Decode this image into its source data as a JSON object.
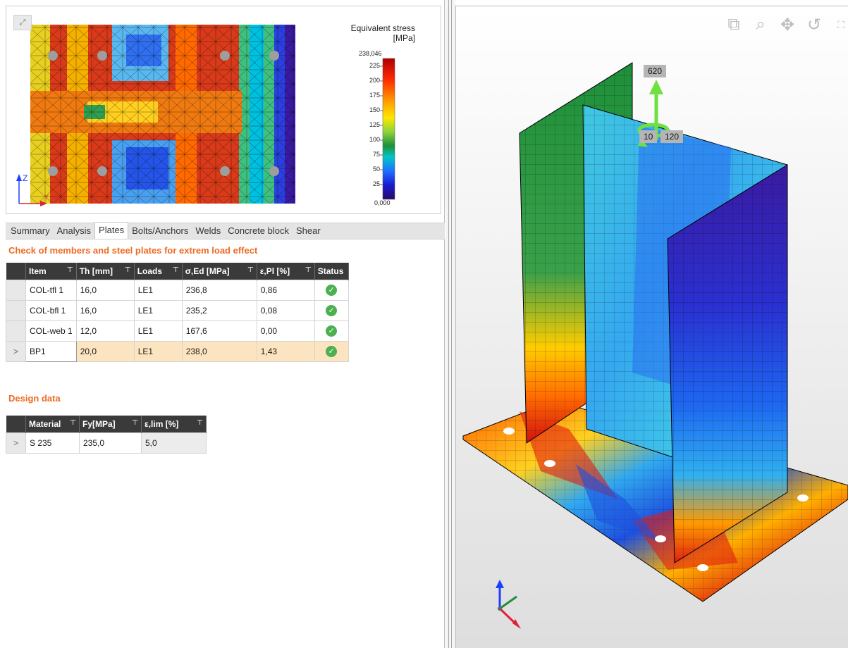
{
  "preview": {
    "legend_title": "Equivalent stress\n[MPa]",
    "legend_max": "238,046",
    "legend_min": "0,000",
    "legend_ticks": [
      "225",
      "200",
      "175",
      "150",
      "125",
      "100",
      "75",
      "50",
      "25"
    ],
    "axis_z": "Z",
    "axis_y": "Y"
  },
  "tabs": [
    {
      "label": "Summary"
    },
    {
      "label": "Analysis"
    },
    {
      "label": "Plates",
      "active": true
    },
    {
      "label": "Bolts/Anchors"
    },
    {
      "label": "Welds"
    },
    {
      "label": "Concrete block"
    },
    {
      "label": "Shear"
    }
  ],
  "check": {
    "title": "Check of members and steel plates for extrem load effect",
    "columns": [
      "Item",
      "Th [mm]",
      "Loads",
      "σ,Ed [MPa]",
      "ε,Pl [%]",
      "Status"
    ],
    "rows": [
      {
        "item": "COL-tfl 1",
        "th": "16,0",
        "loads": "LE1",
        "sigma": "236,8",
        "eps": "0,86"
      },
      {
        "item": "COL-bfl 1",
        "th": "16,0",
        "loads": "LE1",
        "sigma": "235,2",
        "eps": "0,08"
      },
      {
        "item": "COL-web 1",
        "th": "12,0",
        "loads": "LE1",
        "sigma": "167,6",
        "eps": "0,00"
      },
      {
        "item": "BP1",
        "th": "20,0",
        "loads": "LE1",
        "sigma": "238,0",
        "eps": "1,43"
      }
    ]
  },
  "design": {
    "title": "Design data",
    "columns": [
      "Material",
      "Fy[MPa]",
      "ε,lim [%]"
    ],
    "rows": [
      {
        "material": "S 235",
        "fy": "235,0",
        "eps_lim": "5,0"
      }
    ]
  },
  "view3d": {
    "load_top": "620",
    "load_left": "10",
    "load_right": "120",
    "tools": [
      "zoom-window-icon",
      "zoom-icon",
      "pan-icon",
      "rotate-icon",
      "fit-icon"
    ]
  },
  "colors": {
    "accent": "#ee6b22",
    "header": "#3a3a3a",
    "ok": "#4caf50",
    "selected_row": "#fde4c0"
  }
}
